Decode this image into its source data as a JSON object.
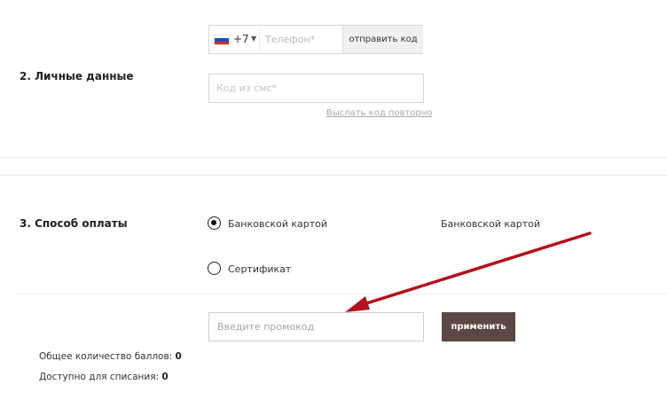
{
  "personal": {
    "title": "2. Личные данные",
    "country_code": "+7",
    "phone_placeholder": "Телефон*",
    "send_code_label": "отправить код",
    "sms_placeholder": "Код из смс*",
    "resend_label": "Выслать код повторно"
  },
  "payment": {
    "title": "3. Способ оплаты",
    "options": [
      {
        "label": "Банковской картой",
        "selected": true
      },
      {
        "label": "Сертификат",
        "selected": false
      }
    ],
    "selected_value": "Банковской картой"
  },
  "promo": {
    "placeholder": "Введите промокод",
    "apply_label": "применить"
  },
  "points": {
    "total_label": "Общее количество баллов:",
    "total_value": "0",
    "available_label": "Доступно для списания:",
    "available_value": "0"
  },
  "colors": {
    "apply_button": "#5b4743",
    "annotation_arrow": "#b3121b",
    "border": "#d6d6d6"
  },
  "icons": {
    "country_flag": "russia-flag-icon",
    "dropdown": "caret-down-icon",
    "annotation": "red-arrow-annotation"
  }
}
